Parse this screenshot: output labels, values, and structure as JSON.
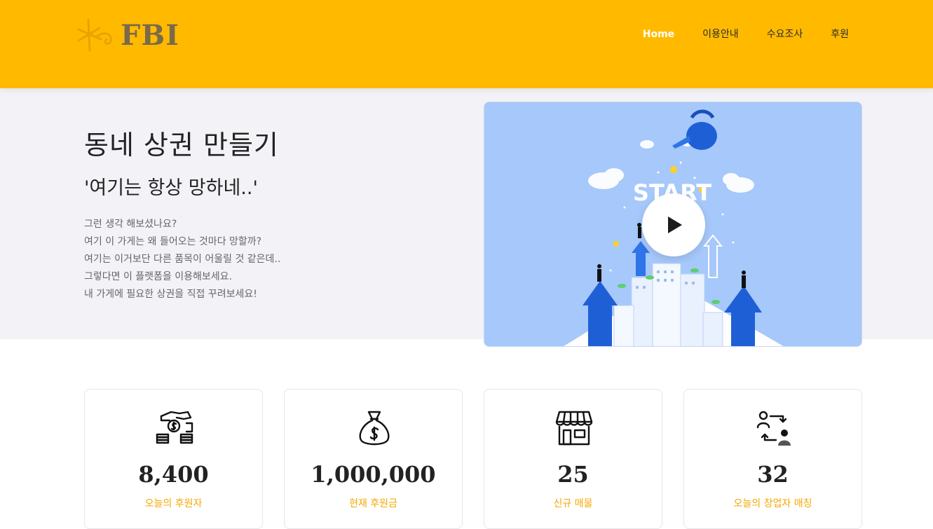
{
  "header": {
    "logo_text": "FBI",
    "nav": [
      {
        "label": "Home",
        "active": true
      },
      {
        "label": "이용안내",
        "active": false
      },
      {
        "label": "수요조사",
        "active": false
      },
      {
        "label": "후원",
        "active": false
      }
    ]
  },
  "hero": {
    "title": "동네 상권 만들기",
    "subtitle": "'여기는 항상 망하네..'",
    "lines": [
      "그런 생각 해보셨나요?",
      "여기 이 가게는 왜 들어오는 것마다 망할까?",
      "여기는 이거보단 다른 품목이 어울릴 것 같은데..",
      "그렇다면 이 플랫폼을 이용해보세요.",
      "내 가게에 필요한 상권을 직접 꾸려보세요!"
    ],
    "video": {
      "overlay_text": "START",
      "play_icon": "play-icon"
    }
  },
  "stats": [
    {
      "icon": "donation-coins-icon",
      "value": "8,400",
      "label": "오늘의 후원자"
    },
    {
      "icon": "money-bag-icon",
      "value": "1,000,000",
      "label": "현재 후원금"
    },
    {
      "icon": "storefront-icon",
      "value": "25",
      "label": "신규 매물"
    },
    {
      "icon": "user-exchange-icon",
      "value": "32",
      "label": "오늘의 창업자 매칭"
    }
  ],
  "colors": {
    "brand": "#ffba00",
    "accent": "#f5a800",
    "hero_bg": "#f3f2f7",
    "video_bg": "#a6c8fb"
  }
}
